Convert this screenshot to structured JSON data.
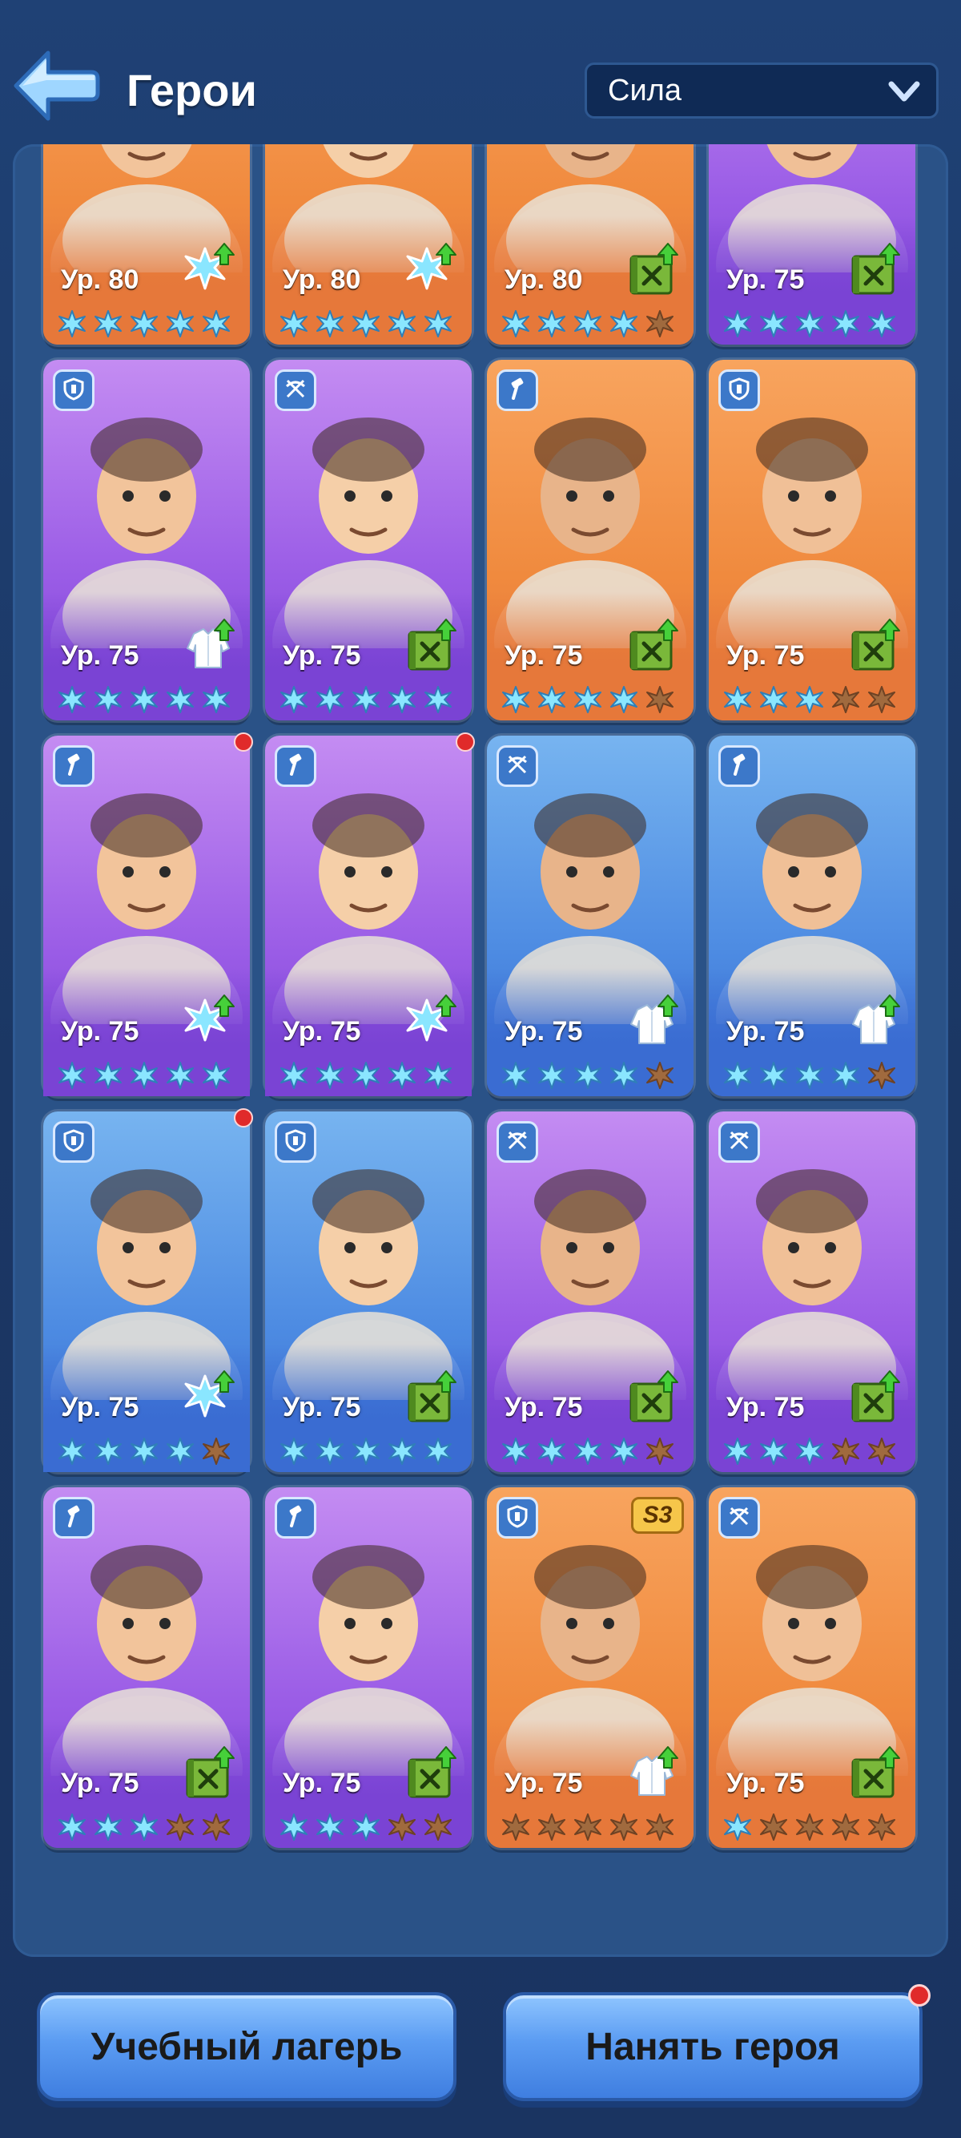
{
  "header": {
    "title": "Герои",
    "sort": {
      "selected": "Сила"
    }
  },
  "level_prefix": "Ур.",
  "heroes": [
    {
      "bg": "orange",
      "role": "",
      "level": "80",
      "upgrade": "star-icon",
      "stars_lit": 5,
      "stars_total": 5,
      "dot": false,
      "season": ""
    },
    {
      "bg": "orange",
      "role": "",
      "level": "80",
      "upgrade": "star-icon",
      "stars_lit": 5,
      "stars_total": 5,
      "dot": false,
      "season": ""
    },
    {
      "bg": "orange",
      "role": "",
      "level": "80",
      "upgrade": "book-icon",
      "stars_lit": 4,
      "stars_total": 5,
      "dot": false,
      "season": ""
    },
    {
      "bg": "purple",
      "role": "",
      "level": "75",
      "upgrade": "book-icon",
      "stars_lit": 5,
      "stars_total": 5,
      "dot": false,
      "season": ""
    },
    {
      "bg": "purple",
      "role": "shield",
      "level": "75",
      "upgrade": "coat-icon",
      "stars_lit": 5,
      "stars_total": 5,
      "dot": false,
      "season": ""
    },
    {
      "bg": "purple",
      "role": "crossbow",
      "level": "75",
      "upgrade": "book-icon",
      "stars_lit": 5,
      "stars_total": 5,
      "dot": false,
      "season": ""
    },
    {
      "bg": "orange",
      "role": "hammer",
      "level": "75",
      "upgrade": "book-icon",
      "stars_lit": 4,
      "stars_total": 5,
      "dot": false,
      "season": ""
    },
    {
      "bg": "orange",
      "role": "shield",
      "level": "75",
      "upgrade": "book-icon",
      "stars_lit": 3,
      "stars_total": 5,
      "dot": false,
      "season": ""
    },
    {
      "bg": "purple",
      "role": "hammer",
      "level": "75",
      "upgrade": "star-icon",
      "stars_lit": 5,
      "stars_total": 5,
      "dot": true,
      "season": ""
    },
    {
      "bg": "purple",
      "role": "hammer",
      "level": "75",
      "upgrade": "star-icon",
      "stars_lit": 5,
      "stars_total": 5,
      "dot": true,
      "season": ""
    },
    {
      "bg": "blue",
      "role": "crossbow",
      "level": "75",
      "upgrade": "coat-icon",
      "stars_lit": 4,
      "stars_total": 5,
      "dot": false,
      "season": ""
    },
    {
      "bg": "blue",
      "role": "hammer",
      "level": "75",
      "upgrade": "coat-icon",
      "stars_lit": 4,
      "stars_total": 5,
      "dot": false,
      "season": ""
    },
    {
      "bg": "blue",
      "role": "shield",
      "level": "75",
      "upgrade": "star-icon",
      "stars_lit": 4,
      "stars_total": 5,
      "dot": true,
      "season": ""
    },
    {
      "bg": "blue",
      "role": "shield",
      "level": "75",
      "upgrade": "book-icon",
      "stars_lit": 5,
      "stars_total": 5,
      "dot": false,
      "season": ""
    },
    {
      "bg": "purple",
      "role": "crossbow",
      "level": "75",
      "upgrade": "book-icon",
      "stars_lit": 4,
      "stars_total": 5,
      "dot": false,
      "season": ""
    },
    {
      "bg": "purple",
      "role": "crossbow",
      "level": "75",
      "upgrade": "book-icon",
      "stars_lit": 3,
      "stars_total": 5,
      "dot": false,
      "season": ""
    },
    {
      "bg": "purple",
      "role": "hammer",
      "level": "75",
      "upgrade": "book-icon",
      "stars_lit": 3,
      "stars_total": 5,
      "dot": false,
      "season": ""
    },
    {
      "bg": "purple",
      "role": "hammer",
      "level": "75",
      "upgrade": "book-icon",
      "stars_lit": 3,
      "stars_total": 5,
      "dot": false,
      "season": ""
    },
    {
      "bg": "orange",
      "role": "shield",
      "level": "75",
      "upgrade": "coat-icon",
      "stars_lit": 0,
      "stars_total": 5,
      "dot": false,
      "season": "S3"
    },
    {
      "bg": "orange",
      "role": "crossbow",
      "level": "75",
      "upgrade": "book-icon",
      "stars_lit": 1,
      "stars_total": 5,
      "dot": false,
      "season": ""
    }
  ],
  "buttons": {
    "train": "Учебный лагерь",
    "hire": "Нанять героя"
  },
  "colors": {
    "background": "#1c3a6b",
    "panel": "#2a5287",
    "button": "#5b9cf2",
    "star_lit": "#8ae6ff",
    "star_empty": "#a06a3e"
  }
}
